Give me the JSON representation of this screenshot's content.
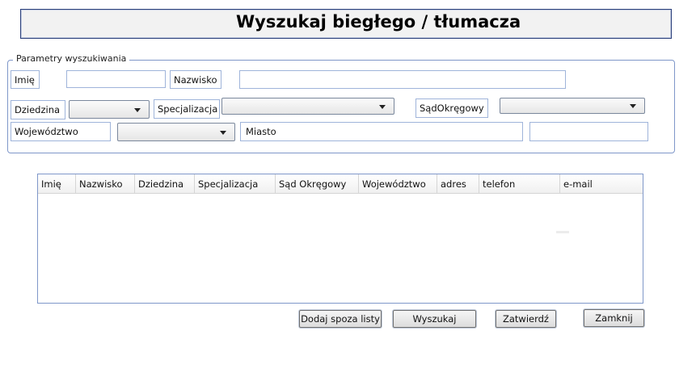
{
  "title": "Wyszukaj biegłego / tłumacza",
  "search_group": {
    "legend": "Parametry wyszukiwania",
    "labels": {
      "imie": "Imię",
      "nazwisko": "Nazwisko",
      "dziedzina": "Dziedzina",
      "specjalizacja": "Specjalizacja",
      "sad_okregowy": "SądOkręgowy",
      "wojewodztwo": "Województwo"
    },
    "fields": {
      "imie": "",
      "nazwisko": "",
      "miasto": "Miasto",
      "extra": ""
    },
    "combos": {
      "dziedzina": "",
      "specjalizacja": "",
      "sad_okregowy": "",
      "wojewodztwo": ""
    }
  },
  "results_table": {
    "columns": [
      "Imię",
      "Nazwisko",
      "Dziedzina",
      "Specjalizacja",
      "Sąd Okręgowy",
      "Województwo",
      "adres",
      "telefon",
      "e-mail"
    ],
    "rows": []
  },
  "buttons": {
    "add_outside": "Dodaj spoza listy",
    "search": "Wyszukaj",
    "confirm": "Zatwierdź",
    "close": "Zamknij"
  }
}
